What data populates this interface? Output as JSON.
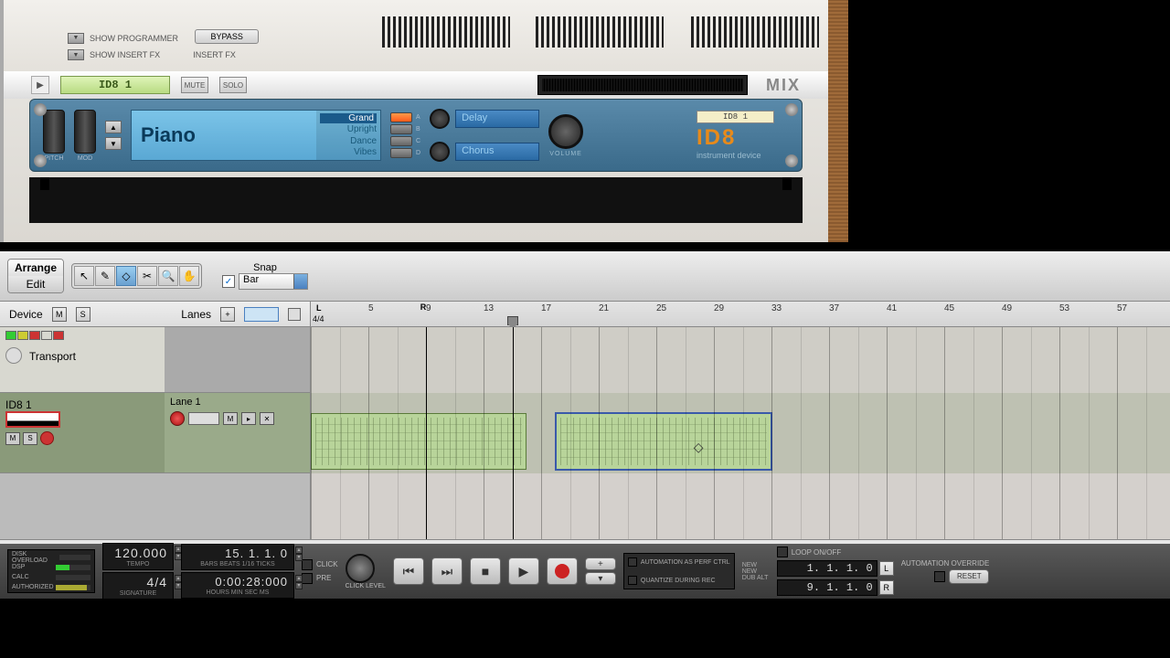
{
  "rack": {
    "show_programmer": "SHOW PROGRAMMER",
    "show_insert_fx": "SHOW INSERT FX",
    "bypass": "BYPASS",
    "insert_fx": "INSERT FX",
    "device_name": "ID8 1",
    "mute": "MUTE",
    "solo": "SOLO",
    "mix": "MIX"
  },
  "id8": {
    "pitch": "PITCH",
    "mod": "MOD",
    "patch": "Piano",
    "categories": [
      "Grand",
      "Upright",
      "Dance",
      "Vibes"
    ],
    "selected_cat": 0,
    "fx1": "Delay",
    "fx2": "Chorus",
    "volume": "VOLUME",
    "name_strip": "ID8 1",
    "logo": "ID8",
    "subtitle": "instrument device"
  },
  "seq": {
    "mode_arrange": "Arrange",
    "mode_edit": "Edit",
    "snap_label": "Snap",
    "snap_value": "Bar",
    "device_hdr": "Device",
    "lanes_hdr": "Lanes",
    "ruler_L": "L",
    "ruler_44": "4/4",
    "ruler_R": "R",
    "bars": [
      5,
      9,
      13,
      17,
      21,
      25,
      29,
      33,
      37,
      41,
      45,
      49,
      53,
      57
    ],
    "loop_left_bar": 9,
    "playhead_bar": 15,
    "tracks": {
      "transport": "Transport",
      "id8": "ID8 1",
      "lane": "Lane 1"
    }
  },
  "transport": {
    "disk": "DISK OVERLOAD",
    "dsp": "DSP",
    "calc": "CALC",
    "auth": "AUTHORIZED",
    "tempo_val": "120.000",
    "tempo_lbl": "TEMPO",
    "sig_val": "4/4",
    "sig_lbl": "SIGNATURE",
    "pos_val": "15.  1.  1.    0",
    "pos_lbl": "BARS  BEATS  1/16  TICKS",
    "time_val": "0:00:28:000",
    "time_lbl": "HOURS   MIN    SEC     MS",
    "click": "CLICK",
    "pre": "PRE",
    "click_level": "CLICK LEVEL",
    "auto_perf": "AUTOMATION AS PERF CTRL",
    "quant_rec": "QUANTIZE DURING REC",
    "new_alt": "NEW NEW DUB ALT",
    "loop_onoff": "LOOP ON/OFF",
    "loop_l": "1.  1.  1.    0",
    "loop_r": "9.  1.  1.    0",
    "auto_override": "AUTOMATION OVERRIDE",
    "reset": "RESET"
  }
}
